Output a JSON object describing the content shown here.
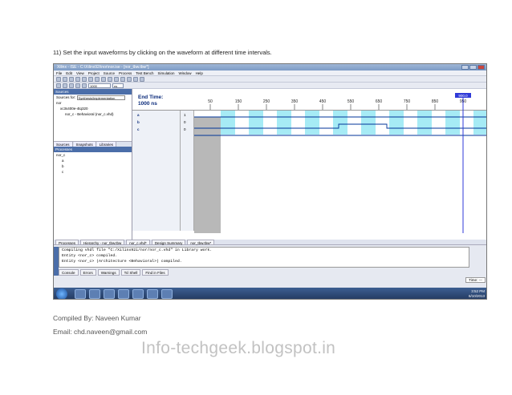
{
  "caption": "11)  Set the input waveforms by clicking on the waveform at different time intervals.",
  "window": {
    "title": "Xilinx - ISE - C:\\Xilinx92i\\nor\\nor.ise - [nor_tbw.tbw*]",
    "menu": [
      "File",
      "Edit",
      "View",
      "Project",
      "Source",
      "Process",
      "Test Bench",
      "Simulation",
      "Window",
      "Help"
    ],
    "toolbar_time": "1000",
    "toolbar_unit": "ns"
  },
  "sources": {
    "header": "Sources",
    "sources_for_label": "Sources for:",
    "sources_for_value": "Synthesis/Implementation",
    "tree": [
      "nor",
      "xc3s400e-4tq320",
      "nor_c - Behavioral (nor_c.vhd)"
    ],
    "tabs": [
      "Sources",
      "Snapshots",
      "Libraries"
    ],
    "processes_header": "Processes",
    "proc_tree": [
      "nor_c",
      "a",
      "b",
      "c"
    ]
  },
  "waveform": {
    "end_time_label": "End Time:",
    "end_time_value": "1000 ns",
    "cursor_label": "900.0",
    "timescale": [
      "50",
      "150",
      "250",
      "350",
      "450",
      "550",
      "650",
      "750",
      "850",
      "950"
    ],
    "signals": [
      {
        "name": "a",
        "value": "1"
      },
      {
        "name": "b",
        "value": "0"
      },
      {
        "name": "c",
        "value": "0"
      }
    ],
    "signal_a_levels": [
      1,
      1,
      1,
      1,
      1,
      1,
      1,
      1,
      1,
      1,
      1,
      1,
      1
    ],
    "signal_b_levels": [
      0,
      0,
      0,
      0,
      0,
      0,
      1,
      1,
      0,
      0,
      0,
      0,
      0
    ],
    "signal_c_levels": [
      0,
      0,
      0,
      0,
      0,
      0,
      0,
      0,
      0,
      0,
      0,
      0,
      0
    ]
  },
  "document_tabs": [
    "Processes",
    "Hierarchy - nor_tbw.tbw",
    "nor_c.vhd*",
    "Design Summary",
    "nor_tbw.tbw*"
  ],
  "console": {
    "lines": [
      "Compiling vhdl file \"C:/Xilinx92i/nor/nor_c.vhd\" in Library work.",
      "Entity <nor_c> compiled.",
      "Entity <nor_c> (Architecture <Behavioral>) compiled."
    ],
    "tabs": [
      "Console",
      "Errors",
      "Warnings",
      "Tcl Shell",
      "Find in Files"
    ],
    "time_label": "Time: ---"
  },
  "taskbar": {
    "clock_time": "3:52 PM",
    "clock_date": "6/10/2013"
  },
  "credits": {
    "compiled_by": "Compiled By: Naveen Kumar",
    "email": "Email: chd.naveen@gmail.com"
  },
  "brand": "Info-techgeek.blogspot.in"
}
